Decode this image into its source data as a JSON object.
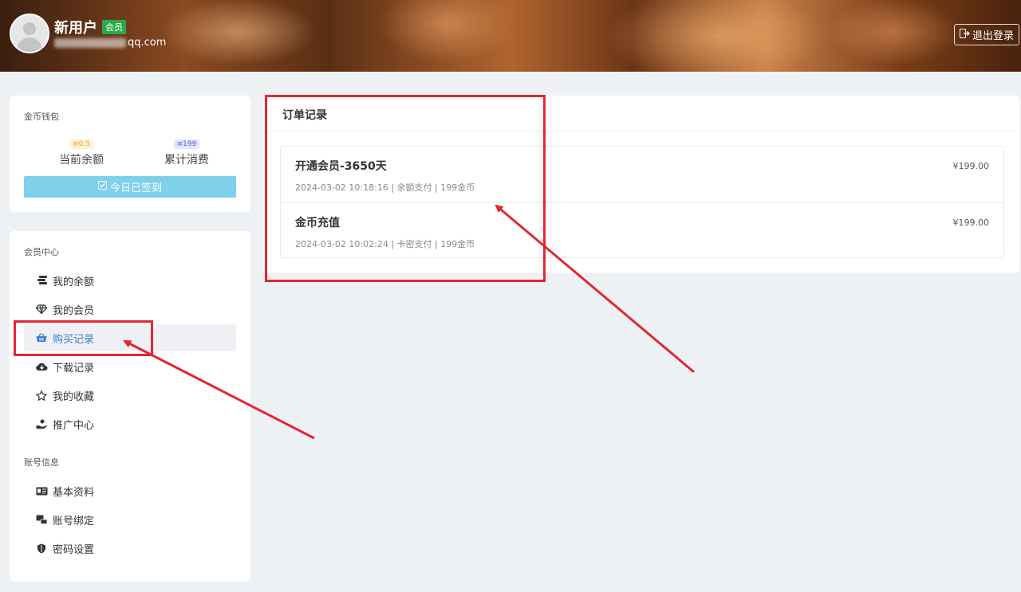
{
  "header": {
    "username": "新用户",
    "vip_badge": "会员",
    "email_suffix": "qq.com",
    "logout_label": "退出登录"
  },
  "wallet": {
    "title": "金币钱包",
    "balance_value": "0.5",
    "balance_label": "当前余额",
    "spent_value": "199",
    "spent_label": "累计消费",
    "checkin_label": "今日已签到"
  },
  "member_center": {
    "title": "会员中心",
    "items": [
      {
        "label": "我的余额",
        "icon": "coins-icon"
      },
      {
        "label": "我的会员",
        "icon": "diamond-icon"
      },
      {
        "label": "购买记录",
        "icon": "basket-icon",
        "active": true
      },
      {
        "label": "下载记录",
        "icon": "cloud-download-icon"
      },
      {
        "label": "我的收藏",
        "icon": "star-icon"
      },
      {
        "label": "推广中心",
        "icon": "hand-coin-icon"
      }
    ],
    "account_title": "账号信息",
    "account_items": [
      {
        "label": "基本资料",
        "icon": "id-card-icon"
      },
      {
        "label": "账号绑定",
        "icon": "link-account-icon"
      },
      {
        "label": "密码设置",
        "icon": "shield-icon"
      }
    ]
  },
  "orders": {
    "title": "订单记录",
    "rows": [
      {
        "name": "开通会员-3650天",
        "meta": "2024-03-02 10:18:16 | 余额支付 | 199金币",
        "price": "¥199.00"
      },
      {
        "name": "金币充值",
        "meta": "2024-03-02 10:02:24 | 卡密支付 | 199金币",
        "price": "¥199.00"
      }
    ]
  },
  "colors": {
    "accent": "#3a7bd5",
    "checkin_bg": "#7fd0ea",
    "annotation_red": "#e32633",
    "vip_green": "#2aa84a"
  }
}
